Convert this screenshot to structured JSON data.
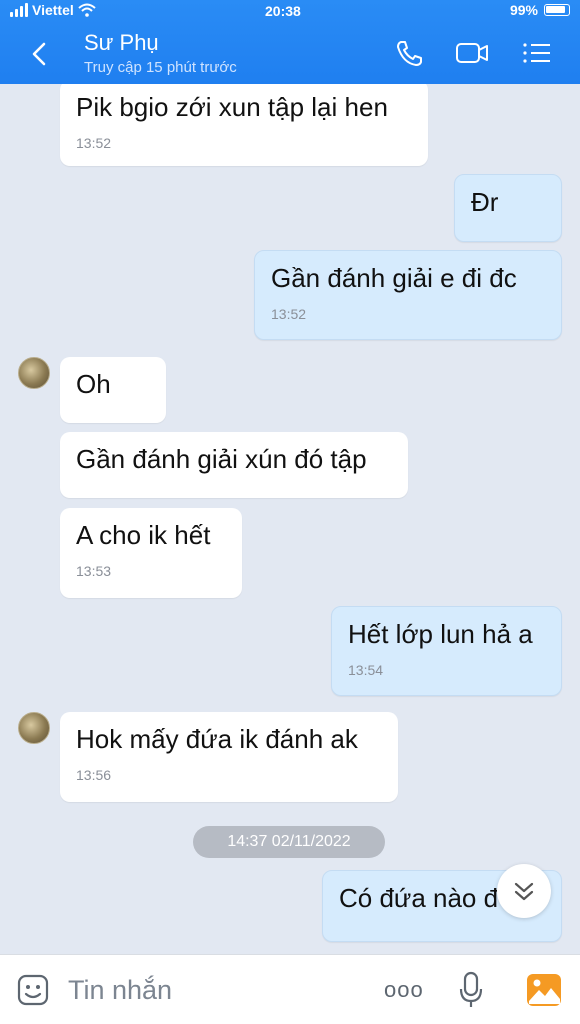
{
  "status_bar": {
    "carrier": "Viettel",
    "time": "20:38",
    "battery": "99%"
  },
  "header": {
    "contact_name": "Sư Phụ",
    "last_seen": "Truy cập 15 phút trước"
  },
  "messages": [
    {
      "direction": "in",
      "text": "Pik bgio zới xun tập lại hen",
      "time": "13:52"
    },
    {
      "direction": "out",
      "text": "Đr",
      "time": ""
    },
    {
      "direction": "out",
      "text": "Gần đánh giải e đi đc",
      "time": "13:52"
    },
    {
      "direction": "in",
      "text": "Oh",
      "time": ""
    },
    {
      "direction": "in",
      "text": "Gần đánh giải xún đó tập",
      "time": ""
    },
    {
      "direction": "in",
      "text": "A cho ik hết",
      "time": "13:53"
    },
    {
      "direction": "out",
      "text": "Hết lớp lun hả a",
      "time": "13:54"
    },
    {
      "direction": "in",
      "text": "Hok mấy đứa ik đánh ak",
      "time": "13:56"
    },
    {
      "direction": "out",
      "text": "Có đứa nào đ",
      "time": ""
    }
  ],
  "date_separator": "14:37 02/11/2022",
  "composer": {
    "placeholder": "Tin nhắn",
    "more_label": "ooo"
  },
  "icons": {
    "back": "chevron-left-icon",
    "call": "phone-icon",
    "video": "video-icon",
    "menu": "list-icon",
    "sticker": "emoji-icon",
    "mic": "microphone-icon",
    "image": "image-icon",
    "scroll": "double-chevron-down-icon"
  },
  "colors": {
    "header": "#1f7ff0",
    "bubble_in": "#ffffff",
    "bubble_out": "#d6ebfd",
    "background": "#e2e8f2",
    "image_icon": "#f59a23"
  }
}
